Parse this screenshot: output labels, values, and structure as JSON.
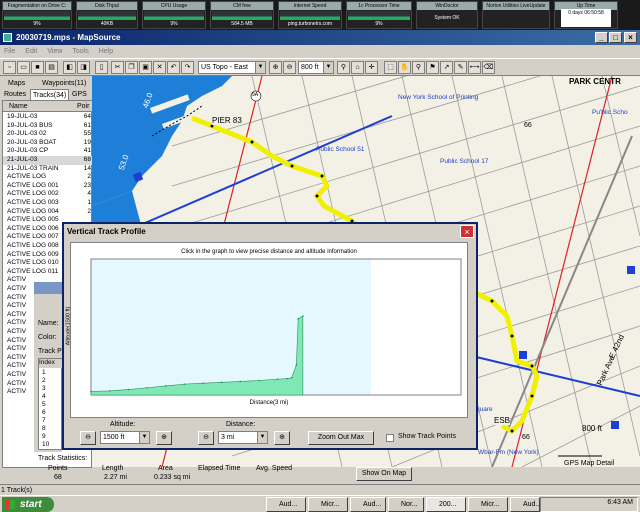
{
  "monitors": [
    {
      "label": "Fragmentation on Drive C:",
      "value": "9%"
    },
    {
      "label": "Disk Thput",
      "value": "40KB"
    },
    {
      "label": "CPU Usage",
      "value": "9%"
    },
    {
      "label": "CM free",
      "value": "584.5 MB"
    },
    {
      "label": "Internet Speed",
      "value": "ping.turbonetrs.com"
    },
    {
      "label": "1c Processor Time",
      "value": "9%"
    },
    {
      "label": "WinDoctor",
      "value": "System OK"
    },
    {
      "label": "Norton Utilities LiveUpdate",
      "value": ""
    },
    {
      "label": "Up Time",
      "value": "0 days 06:50:58"
    }
  ],
  "window": {
    "title": "20030719.mps - MapSource",
    "min": "_",
    "max": "□",
    "close": "×"
  },
  "menu": [
    "File",
    "Edit",
    "View",
    "Tools",
    "Help"
  ],
  "toolbar": {
    "map_product": "US Topo - East",
    "zoom": "800 ft"
  },
  "tabs": {
    "maps": "Maps",
    "waypoints": "Waypoints(11)",
    "routes": "Routes",
    "tracks": "Tracks(34)",
    "gps": "GPS"
  },
  "list": {
    "col_name": "Name",
    "col_points": "Poir",
    "rows": [
      {
        "name": "19-JUL-03",
        "points": "64"
      },
      {
        "name": "19-JUL-03 BUS",
        "points": "61"
      },
      {
        "name": "20-JUL-03 02",
        "points": "55"
      },
      {
        "name": "20-JUL-03 BOAT",
        "points": "19"
      },
      {
        "name": "20-JUL-03 CP",
        "points": "41"
      },
      {
        "name": "21-JUL-03",
        "points": "68"
      },
      {
        "name": "21-JUL-03 TRAIN",
        "points": "14"
      },
      {
        "name": "ACTIVE LOG",
        "points": "2"
      },
      {
        "name": "ACTIVE LOG 001",
        "points": "23"
      },
      {
        "name": "ACTIVE LOG 002",
        "points": "4"
      },
      {
        "name": "ACTIVE LOG 003",
        "points": "1"
      },
      {
        "name": "ACTIVE LOG 004",
        "points": "2"
      },
      {
        "name": "ACTIVE LOG 005",
        "points": ""
      },
      {
        "name": "ACTIVE LOG 006",
        "points": ""
      },
      {
        "name": "ACTIVE LOG 007",
        "points": ""
      },
      {
        "name": "ACTIVE LOG 008",
        "points": ""
      },
      {
        "name": "ACTIVE LOG 009",
        "points": ""
      },
      {
        "name": "ACTIVE LOG 010",
        "points": ""
      },
      {
        "name": "ACTIVE LOG 011",
        "points": ""
      },
      {
        "name": "ACTIV",
        "points": ""
      },
      {
        "name": "ACTIV",
        "points": ""
      },
      {
        "name": "ACTIV",
        "points": ""
      },
      {
        "name": "ACTIV",
        "points": ""
      },
      {
        "name": "ACTIV",
        "points": ""
      },
      {
        "name": "ACTIV",
        "points": ""
      },
      {
        "name": "ACTIV",
        "points": ""
      },
      {
        "name": "ACTIV",
        "points": ""
      },
      {
        "name": "ACTIV",
        "points": ""
      },
      {
        "name": "ACTIV",
        "points": ""
      },
      {
        "name": "ACTIV",
        "points": ""
      },
      {
        "name": "ACTIV",
        "points": ""
      },
      {
        "name": "ACTIV",
        "points": ""
      },
      {
        "name": "ACTIV",
        "points": ""
      }
    ]
  },
  "map_labels": {
    "park_centr": "PARK CENTR",
    "pier": "PIER 83",
    "ny_school": "New York School of Printing",
    "ps51": "Public School 51",
    "ps17": "Public School 17",
    "pub_school_edge": "Pu'blic Scho",
    "esb": "ESB",
    "park_ave": "Park Ave",
    "st42": "E 42nd",
    "scale": "800 ft",
    "gps_detail": "GPS Map Detail",
    "route66": "66",
    "route66b": "66",
    "depth1": "46.0",
    "depth2": "53.0",
    "hwy": "1",
    "route9a": "9A",
    "wbar": "Wbar-Fm (New York)",
    "square": "quare"
  },
  "profile": {
    "title": "Vertical Track Profile",
    "hint": "Click in the graph to view precise distance and altitude information",
    "ylabel": "Altitude(1500 ft)",
    "xlabel": "Distance(3 mi)",
    "altitude_label": "Altitude:",
    "altitude_value": "1500 ft",
    "distance_label": "Distance:",
    "distance_value": "3 mi",
    "zoom_out_max": "Zoom Out Max",
    "show_track_points": "Show Track Points"
  },
  "chart_data": {
    "type": "area",
    "xlabel": "Distance(3 mi)",
    "ylabel": "Altitude(1500 ft)",
    "xlim": [
      0,
      3
    ],
    "ylim": [
      0,
      1500
    ],
    "x": [
      0,
      0.2,
      0.4,
      0.6,
      0.8,
      1.0,
      1.2,
      1.4,
      1.6,
      1.8,
      2.0,
      2.1,
      2.15,
      2.2,
      2.22,
      2.27
    ],
    "y": [
      40,
      45,
      60,
      80,
      100,
      120,
      130,
      140,
      150,
      160,
      175,
      180,
      190,
      330,
      840,
      870
    ]
  },
  "track_props": {
    "name_label": "Name:",
    "color_label": "Color:",
    "points_label": "Track P",
    "index_header": "Index",
    "indexes": [
      "1",
      "2",
      "3",
      "4",
      "5",
      "6",
      "7",
      "8",
      "9",
      "10"
    ]
  },
  "stats": {
    "label": "Track Statistics:",
    "headers": [
      "Points",
      "Length",
      "Area",
      "Elapsed Time",
      "Avg. Speed"
    ],
    "values": [
      "68",
      "2.27 mi",
      "0.233 sq mi",
      "",
      ""
    ],
    "show_on_map": "Show On Map"
  },
  "status": {
    "left": "1 Track(s)"
  },
  "taskbar": {
    "start": "start",
    "tasks": [
      "Aud...",
      "Micr...",
      "Aud...",
      "Nor...",
      "200...",
      "Micr...",
      "Aud..."
    ],
    "clock": "6:43 AM"
  },
  "colors": {
    "water": "#1e7fd8",
    "track": "#f0f000",
    "profile_fill": "#7fe8b4",
    "highway": "#1d3fd6",
    "titlebar": "#0a246a"
  }
}
